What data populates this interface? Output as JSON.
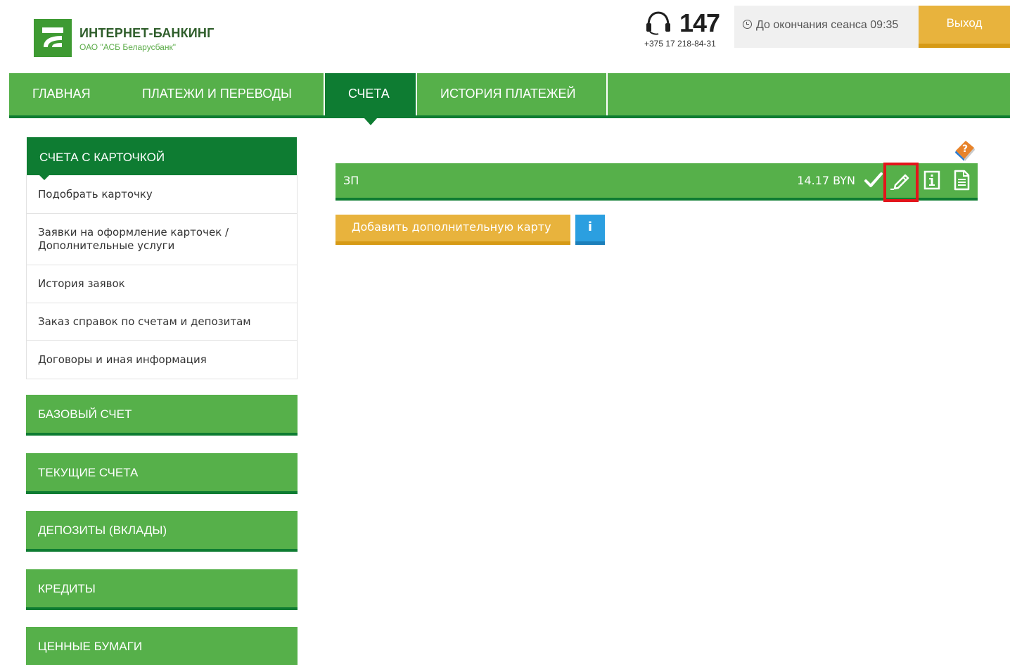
{
  "header": {
    "brand_title": "ИНТЕРНЕТ-БАНКИНГ",
    "brand_subtitle": "ОАО \"АСБ Беларусбанк\"",
    "phone_short": "147",
    "phone_full": "+375 17 218-84-31",
    "session_label": "До окончания сеанса 09:35",
    "logout_label": "Выход"
  },
  "nav": {
    "items": [
      {
        "label": "ГЛАВНАЯ",
        "active": false
      },
      {
        "label": "ПЛАТЕЖИ И ПЕРЕВОДЫ",
        "active": false
      },
      {
        "label": "СЧЕТА",
        "active": true
      },
      {
        "label": "ИСТОРИЯ ПЛАТЕЖЕЙ",
        "active": false
      }
    ]
  },
  "sidebar": {
    "active_group": "СЧЕТА С КАРТОЧКОЙ",
    "sub_items": [
      "Подобрать карточку",
      "Заявки на оформление карточек / Дополнительные услуги",
      "История заявок",
      "Заказ справок по счетам и депозитам",
      "Договоры и иная информация"
    ],
    "groups": [
      "БАЗОВЫЙ СЧЕТ",
      "ТЕКУЩИЕ СЧЕТА",
      "ДЕПОЗИТЫ (ВКЛАДЫ)",
      "КРЕДИТЫ",
      "ЦЕННЫЕ БУМАГИ"
    ]
  },
  "account": {
    "name": "ЗП",
    "balance": "14.17 BYN",
    "icons": [
      "check-icon",
      "edit-pencil-icon",
      "info-icon",
      "document-icon"
    ]
  },
  "actions": {
    "add_card_label": "Добавить дополнительную карту",
    "info_label": "i"
  },
  "colors": {
    "brand_green": "#56b04a",
    "dark_green": "#0e7c32",
    "orange": "#e8b33d",
    "info_blue": "#2b9fe0",
    "highlight_red": "#e3141b"
  }
}
